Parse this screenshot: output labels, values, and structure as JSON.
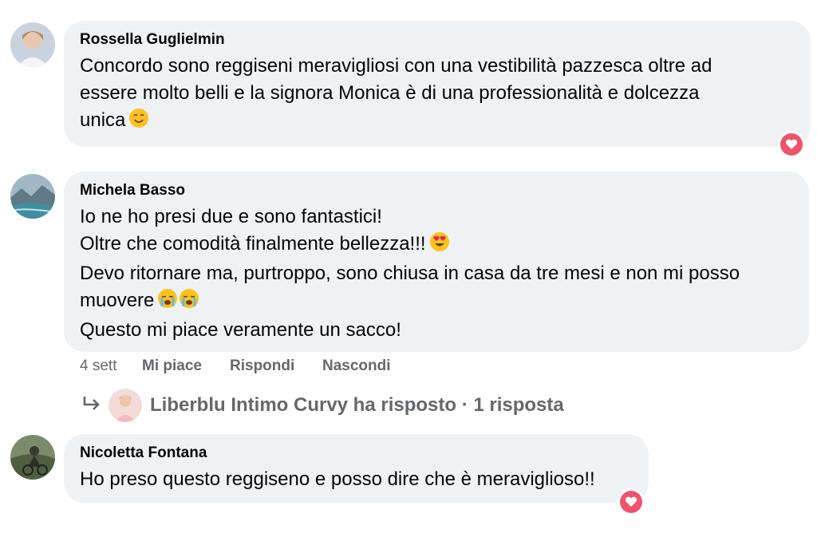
{
  "comments": [
    {
      "author": "Rossella Guglielmin",
      "lines": [
        "Concordo sono reggiseni meravigliosi con una vestibilità pazzesca oltre ad",
        "essere molto belli e la signora Monica è di una professionalità e dolcezza",
        "unica"
      ],
      "emoji_after_last": "smiling-face-emoji",
      "reaction": "love-reaction-icon"
    },
    {
      "author": "Michela Basso",
      "lines": [
        "Io ne ho presi due e sono fantastici!",
        "Oltre che comodità finalmente bellezza!!!",
        "Devo ritornare ma, purtroppo, sono chiusa in casa da tre mesi e non mi posso",
        "muovere",
        "Questo mi piace veramente un sacco!"
      ],
      "actions": {
        "time": "4 sett",
        "like": "Mi piace",
        "reply": "Rispondi",
        "hide": "Nascondi"
      },
      "reply_summary": {
        "text": "Liberblu Intimo Curvy ha risposto · 1 risposta",
        "icon": "reply-arrow-icon"
      }
    },
    {
      "author": "Nicoletta Fontana",
      "lines": [
        "Ho preso questo reggiseno e posso dire che è meraviglioso!!"
      ],
      "reaction": "love-reaction-icon"
    }
  ],
  "colors": {
    "bubble": "#eff2f5",
    "secondary_text": "#65676b",
    "love": "#f0536b"
  }
}
